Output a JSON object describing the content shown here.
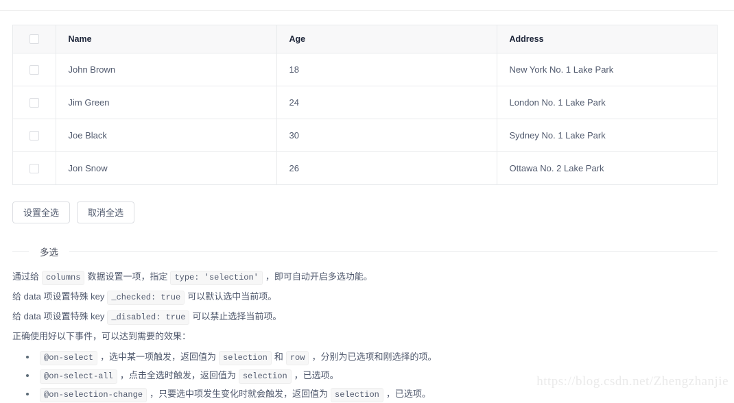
{
  "table": {
    "select_all_checkbox": "checkbox-unchecked",
    "columns": [
      {
        "key": "selection",
        "label": ""
      },
      {
        "key": "name",
        "label": "Name"
      },
      {
        "key": "age",
        "label": "Age"
      },
      {
        "key": "address",
        "label": "Address"
      }
    ],
    "rows": [
      {
        "name": "John Brown",
        "age": "18",
        "address": "New York No. 1 Lake Park",
        "checked": false
      },
      {
        "name": "Jim Green",
        "age": "24",
        "address": "London No. 1 Lake Park",
        "checked": false
      },
      {
        "name": "Joe Black",
        "age": "30",
        "address": "Sydney No. 1 Lake Park",
        "checked": false
      },
      {
        "name": "Jon Snow",
        "age": "26",
        "address": "Ottawa No. 2 Lake Park",
        "checked": false
      }
    ]
  },
  "buttons": {
    "set_all": "设置全选",
    "cancel_all": "取消全选"
  },
  "section": {
    "title": "多选"
  },
  "prose": {
    "line1": {
      "t1": "通过给",
      "code1": "columns",
      "t2": "数据设置一项，指定",
      "code2": "type: 'selection'",
      "t3": "，即可自动开启多选功能。"
    },
    "line2": {
      "t1": "给 data 项设置特殊 key",
      "code1": "_checked: true",
      "t2": "可以默认选中当前项。"
    },
    "line3": {
      "t1": "给 data 项设置特殊 key",
      "code1": "_disabled: true",
      "t2": "可以禁止选择当前项。"
    },
    "line4": "正确使用好以下事件，可以达到需要的效果："
  },
  "events": [
    {
      "code": "@on-select",
      "t1": "，选中某一项触发，返回值为",
      "code2": "selection",
      "t2": "和",
      "code3": "row",
      "t3": "，分别为已选项和刚选择的项。"
    },
    {
      "code": "@on-select-all",
      "t1": "，点击全选时触发，返回值为",
      "code2": "selection",
      "t2": "，已选项。"
    },
    {
      "code": "@on-selection-change",
      "t1": "，只要选中项发生变化时就会触发，返回值为",
      "code2": "selection",
      "t2": "，已选项。"
    }
  ],
  "watermark": {
    "text": "https://blog.csdn.net/Zhengzhanjie"
  },
  "colors": {
    "border": "#e8eaec",
    "header_bg": "#f8f8f9",
    "header_text": "#1c2438",
    "body_text": "#515a6e",
    "chip_bg": "#f7f7f7",
    "watermark": "#eaeaea"
  }
}
